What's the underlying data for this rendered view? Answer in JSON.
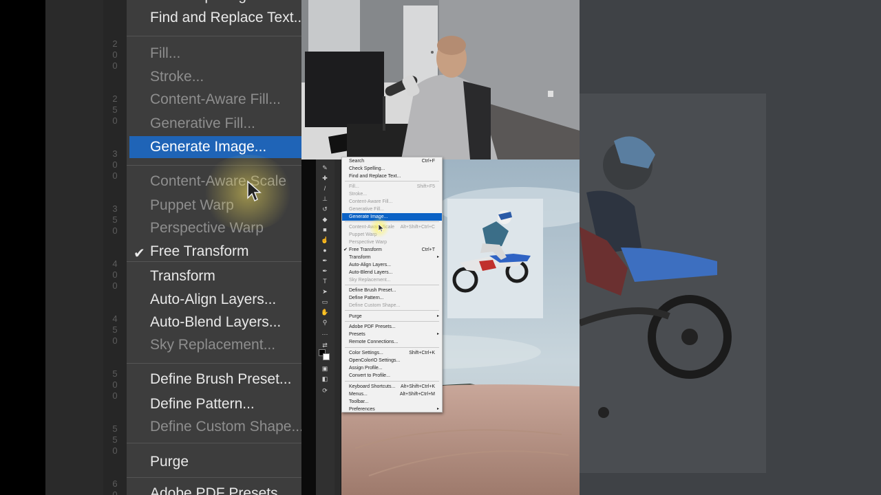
{
  "menu": {
    "items": [
      {
        "label": "Search",
        "shortcut": "Ctrl+F",
        "state": "normal"
      },
      {
        "label": "Check Spelling...",
        "state": "normal"
      },
      {
        "label": "Find and Replace Text...",
        "state": "normal"
      },
      {
        "label": "Fill...",
        "shortcut": "Shift+F5",
        "state": "disabled"
      },
      {
        "label": "Stroke...",
        "state": "disabled"
      },
      {
        "label": "Content-Aware Fill...",
        "state": "disabled"
      },
      {
        "label": "Generative Fill...",
        "state": "disabled"
      },
      {
        "label": "Generate Image...",
        "state": "highlighted"
      },
      {
        "label": "Content-Aware Scale",
        "shortcut": "Alt+Shift+Ctrl+C",
        "state": "disabled"
      },
      {
        "label": "Puppet Warp",
        "state": "disabled"
      },
      {
        "label": "Perspective Warp",
        "state": "disabled"
      },
      {
        "label": "Free Transform",
        "shortcut": "Ctrl+T",
        "state": "checked"
      },
      {
        "label": "Transform",
        "state": "submenu"
      },
      {
        "label": "Auto-Align Layers...",
        "state": "normal"
      },
      {
        "label": "Auto-Blend Layers...",
        "state": "normal"
      },
      {
        "label": "Sky Replacement...",
        "state": "disabled"
      },
      {
        "label": "Define Brush Preset...",
        "state": "normal"
      },
      {
        "label": "Define Pattern...",
        "state": "normal"
      },
      {
        "label": "Define Custom Shape...",
        "state": "disabled"
      },
      {
        "label": "Purge",
        "state": "submenu"
      },
      {
        "label": "Adobe PDF Presets...",
        "state": "normal"
      },
      {
        "label": "Presets",
        "state": "submenu"
      },
      {
        "label": "Remote Connections...",
        "state": "normal"
      },
      {
        "label": "Color Settings...",
        "shortcut": "Shift+Ctrl+K",
        "state": "normal"
      },
      {
        "label": "OpenColorIO Settings...",
        "state": "normal"
      },
      {
        "label": "Assign Profile...",
        "state": "normal"
      },
      {
        "label": "Convert to Profile...",
        "state": "normal"
      },
      {
        "label": "Keyboard Shortcuts...",
        "shortcut": "Alt+Shift+Ctrl+K",
        "state": "normal"
      },
      {
        "label": "Menus...",
        "shortcut": "Alt+Shift+Ctrl+M",
        "state": "normal"
      },
      {
        "label": "Toolbar...",
        "state": "normal"
      },
      {
        "label": "Preferences",
        "state": "submenu"
      }
    ]
  },
  "zoomed_menu": {
    "items": [
      "Check Spelling...",
      "Find and Replace Text...",
      "Fill...",
      "Stroke...",
      "Content-Aware Fill...",
      "Generative Fill...",
      "Generate Image...",
      "Content-Aware Scale",
      "Puppet Warp",
      "Perspective Warp",
      "Free Transform",
      "Transform",
      "Auto-Align Layers...",
      "Auto-Blend Layers...",
      "Sky Replacement...",
      "Define Brush Preset...",
      "Define Pattern...",
      "Define Custom Shape...",
      "Purge",
      "Adobe PDF Presets..."
    ],
    "ruler_labels": [
      "2",
      "0",
      "0",
      "2",
      "5",
      "0",
      "3",
      "0",
      "0",
      "3",
      "5",
      "0",
      "4",
      "0",
      "0",
      "4",
      "5",
      "0",
      "5",
      "0",
      "0",
      "5",
      "5",
      "0",
      "6",
      "0",
      "0"
    ]
  },
  "colors": {
    "menu_bg": "#f1f1f1",
    "highlight": "#0b62c5",
    "ps_panel": "#303030",
    "zoom_highlight": "#1f64b7"
  },
  "icons": {
    "check": "✔",
    "submenu": "▸",
    "cursor": "pointer-arrow"
  }
}
